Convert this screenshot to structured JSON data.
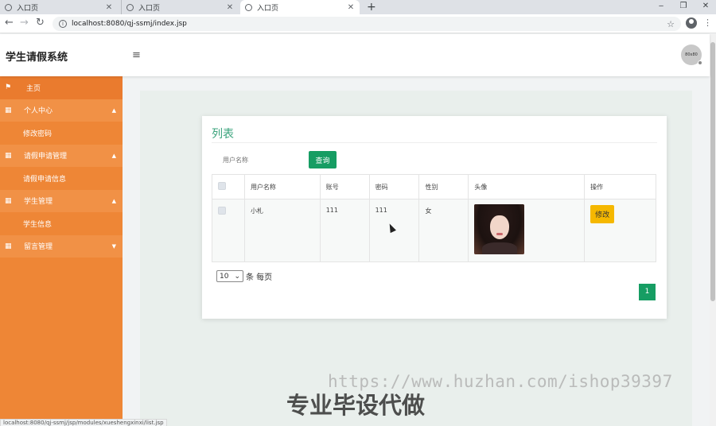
{
  "browser": {
    "tabs": [
      {
        "label": "入口页",
        "close": "✕"
      },
      {
        "label": "入口页",
        "close": "✕"
      },
      {
        "label": "入口页",
        "close": "✕"
      }
    ],
    "new_tab": "+",
    "window_controls": {
      "minimize": "‒",
      "restore": "❐",
      "close": "✕"
    },
    "nav": {
      "back": "←",
      "forward": "→",
      "reload": "↻"
    },
    "url": "localhost:8080/qj-ssmj/index.jsp",
    "bookmark_icon": "☆",
    "menu_icon": "⋮"
  },
  "header": {
    "brand": "学生请假系统",
    "menu_toggle": "≡",
    "avatar_text": "80x80"
  },
  "sidebar": {
    "items": [
      {
        "label": "主页",
        "type": "home",
        "icon": "flag-icon",
        "glyph": "⚑"
      },
      {
        "label": "个人中心",
        "type": "group",
        "icon": "grid-icon",
        "glyph": "▦",
        "caret": "▲"
      },
      {
        "label": "修改密码",
        "type": "sub"
      },
      {
        "label": "请假申请管理",
        "type": "group",
        "icon": "grid-icon",
        "glyph": "▦",
        "caret": "▲"
      },
      {
        "label": "请假申请信息",
        "type": "sub"
      },
      {
        "label": "学生管理",
        "type": "group",
        "icon": "grid-icon",
        "glyph": "▦",
        "caret": "▲"
      },
      {
        "label": "学生信息",
        "type": "sub"
      },
      {
        "label": "留言管理",
        "type": "group",
        "icon": "grid-icon",
        "glyph": "▦",
        "caret": "▼"
      }
    ]
  },
  "main": {
    "title": "列表",
    "search": {
      "placeholder": "用户名称",
      "button": "查询"
    },
    "table": {
      "columns": [
        "",
        "用户名称",
        "账号",
        "密码",
        "性别",
        "头像",
        "操作"
      ],
      "rows": [
        {
          "username": "小札",
          "account": "111",
          "password": "111",
          "gender": "女",
          "action": "修改"
        }
      ]
    },
    "pager": {
      "page_size": "10",
      "page_size_caret": "⌄",
      "page_size_label": "条 每页",
      "current_page": "1"
    }
  },
  "overlays": {
    "watermark_url": "https://www.huzhan.com/ishop39397",
    "watermark_cn": "专业毕设代做",
    "status_url": "localhost:8080/qj-ssmj/jsp/modules/xueshengxinxi/list.jsp"
  },
  "colors": {
    "sidebar": "#ee8636",
    "sidebar_group": "#f19146",
    "accent_green": "#169d63",
    "title_green": "#3aa37c",
    "edit_button": "#f5b800"
  }
}
